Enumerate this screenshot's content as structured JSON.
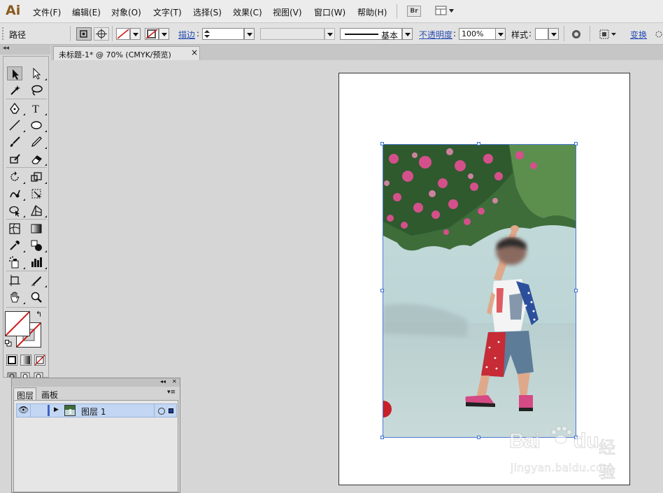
{
  "app": {
    "logo": "Ai"
  },
  "menu": [
    "文件(F)",
    "编辑(E)",
    "对象(O)",
    "文字(T)",
    "选择(S)",
    "效果(C)",
    "视图(V)",
    "窗口(W)",
    "帮助(H)"
  ],
  "menubar_buttons": {
    "bridge": "Br"
  },
  "control_bar": {
    "selection_type": "路径",
    "stroke_label": "描边",
    "stroke_style": "基本",
    "opacity_label": "不透明度",
    "opacity_value": "100%",
    "style_label": "样式",
    "transform_label": "变换"
  },
  "document_tab": {
    "title": "未标题-1* @ 70% (CMYK/预览)",
    "close": "×"
  },
  "layers_panel": {
    "tabs": [
      "图层",
      "画板"
    ],
    "collapse": "◂◂",
    "close": "✕",
    "menu": "▾≡",
    "layer_name": "图层 1"
  },
  "watermark": {
    "brand": "Bai",
    "brand2": "du",
    "label": "经验",
    "url": "jingyan.baidu.com"
  },
  "colors": {
    "accent": "#2a4fb3",
    "selection": "#4a79d6",
    "logo": "#8a5a1e",
    "layer_row": "#c3d7f4"
  }
}
